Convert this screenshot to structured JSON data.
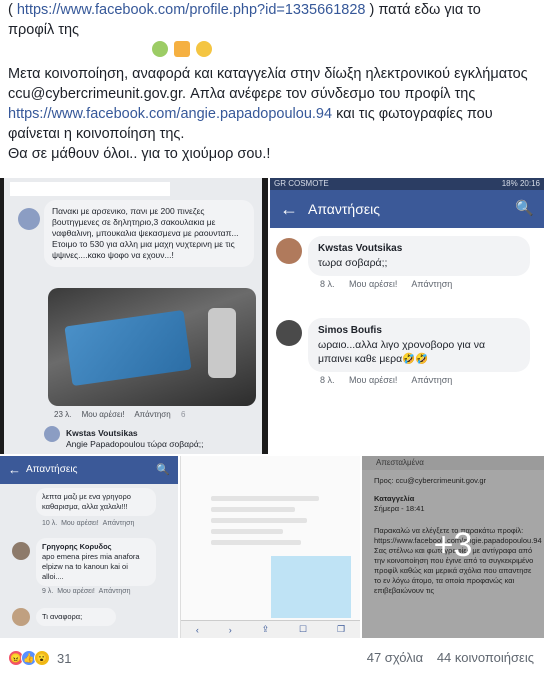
{
  "post": {
    "line1_prefix": "( ",
    "profile_link": "https://www.facebook.com/profile.php?id=1335661828",
    "line1_suffix": " ) πατά εδω για το",
    "line2": "προφίλ της",
    "para_a": "Μετα κοινοποίηση, αναφορά και καταγγελία στην δίωξη ηλεκτρονικού εγκλήματος ccu@cybercrimeunit.gov.gr. Απλα ανέφερε τον σύνδεσμο του προφίλ της ",
    "fb_link": "https://www.facebook.com/angie.papadopoulou.94",
    "para_b": " και τις φωτογραφίες που φαίνεται η κοινοποίηση της.",
    "para_c": "Θα σε μάθουν όλοι.. για το χιούμορ σου.!"
  },
  "shotA": {
    "comment": "Πανακι με αρσενικο, πανι με 200 πινεζες βουτηγμενες σε δηλητηριο,3 σακουλακια με ναφθαλινη, μπουκαλια ψεκασμενα με ραουνταπ... Ετοιμο το 530 για αλλη μια μαχη νυχτερινη με τις ψψινες....κακο ψοφο να εχουν...!",
    "time": "23 λ.",
    "like": "Μου αρέσει!",
    "reply": "Απάντηση",
    "count": "6",
    "reply_name": "Kwstas Voutsikas",
    "reply_text": "Angie Papadopoulou τώρα σοβαρά;;"
  },
  "shotB": {
    "status_left": "GR COSMOTE",
    "status_right": "18% 20:16",
    "title": "Απαντήσεις",
    "c1_name": "Kwstas Voutsikas",
    "c1_text": "τωρα σοβαρά;;",
    "c1_time": "8 λ.",
    "c2_name": "Simos Boufis",
    "c2_text": "ωραιο...αλλα λιγο χρονοβορο για να μπαινει καθε μερα🤣🤣",
    "c2_time": "8 λ.",
    "like": "Μου αρέσει!",
    "reply": "Απάντηση"
  },
  "shotC": {
    "title": "Απαντήσεις",
    "t1": "λεπτα μαζι με ενα γρηγορο καθαρισμα, αλλα χαλαλι!!!",
    "t1_time": "10 λ.",
    "name2": "Γρηγορης Κορυδος",
    "t2": "apo emena pires mia anafora elpizw na to kanoun kai oi alloi....",
    "t2_time": "9 λ.",
    "t3": "Τι αναφορα;",
    "like": "Μου αρέσει!",
    "reply": "Απάντηση"
  },
  "shotE": {
    "header": "Απεσταλμένα",
    "to": "Προς: ccu@cybercrimeunit.gov.gr",
    "subject": "Καταγγελία",
    "date": "Σήμερα - 18:41",
    "body": "Παρακαλώ να ελέγξετε το παρακάτω προφίλ: https://www.facebook.com/angie.papadopoulou.94 Σας στέλνω και φωτογραφίες με αντίγραφα από την κοινοποίηση που έγινε από το συγκεκριμένο προφίλ καθώς και μερικά σχόλια που απαντησε το εν λόγω άτομο, τα οποία προφανώς και επιβεβαιώνουν τις",
    "more": "+3"
  },
  "footer": {
    "reaction_count": "31",
    "comments": "47 σχόλια",
    "shares": "44 κοινοποιήσεις"
  },
  "colors": {
    "fb_blue": "#3b5998",
    "link": "#365899"
  }
}
